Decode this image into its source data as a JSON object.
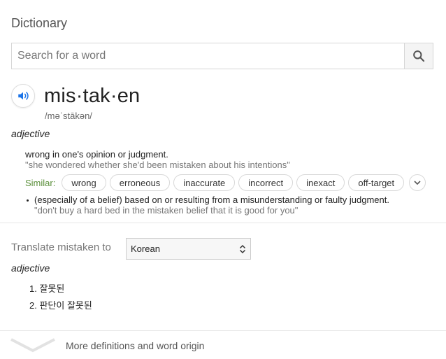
{
  "header": {
    "title": "Dictionary"
  },
  "search": {
    "placeholder": "Search for a word",
    "value": ""
  },
  "entry": {
    "word": "mis·tak·en",
    "phonetic": "/məˈstākən/",
    "part_of_speech": "adjective",
    "definitions": [
      {
        "text": "wrong in one's opinion or judgment.",
        "example": "\"she wondered whether she'd been mistaken about his intentions\"",
        "similar_label": "Similar:",
        "similar": [
          "wrong",
          "erroneous",
          "inaccurate",
          "incorrect",
          "inexact",
          "off-target"
        ]
      },
      {
        "text": "(especially of a belief) based on or resulting from a misunderstanding or faulty judgment.",
        "example": "\"don't buy a hard bed in the mistaken belief that it is good for you\""
      }
    ]
  },
  "translate": {
    "label": "Translate mistaken to",
    "selected_language": "Korean",
    "part_of_speech": "adjective",
    "results": [
      "1. 잘못된",
      "2. 판단이 잘못된"
    ]
  },
  "footer": {
    "more_label": "More definitions and word origin"
  },
  "icons": {
    "search": "search-icon",
    "speaker": "speaker-icon",
    "expand": "chevron-down-icon",
    "select": "select-arrows-icon",
    "more": "chevron-down-icon"
  },
  "colors": {
    "similar_label": "#5a8f3a",
    "speaker": "#1a73e8"
  }
}
